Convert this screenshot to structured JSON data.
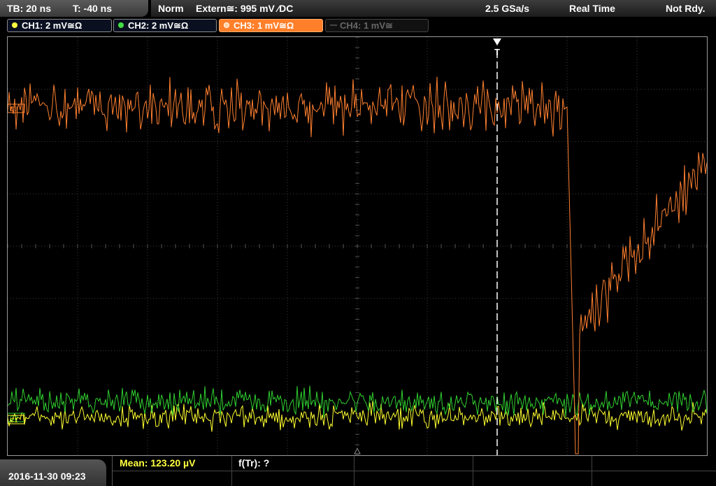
{
  "timebase": {
    "tb": "TB: 20 ns",
    "trigger_time": "T: -40 ns"
  },
  "status": {
    "mode": "Norm",
    "source": "Extern≅: 995 mV ⁄DC",
    "sample_rate": "2.5 GSa/s",
    "acq": "Real Time",
    "ready": "Not Rdy."
  },
  "channels": [
    {
      "label": "CH1: 2 mV≅Ω",
      "color": "#ffff40",
      "state": "on"
    },
    {
      "label": "CH2: 2 mV≅Ω",
      "color": "#40e040",
      "state": "on"
    },
    {
      "label": "CH3: 1 mV≅Ω",
      "color": "#ff7f2a",
      "state": "selected"
    },
    {
      "label": "CH4: 1 mV≅",
      "color": "#555555",
      "state": "off"
    }
  ],
  "markers": {
    "trigger": "T",
    "ch3": "C3",
    "ch1": "C1",
    "ch2": "C2"
  },
  "colors": {
    "ch1": "#ffff30",
    "ch2": "#30d030",
    "ch3": "#ff8030",
    "grid": "#3a3a3a"
  },
  "bottom": {
    "datetime": "2016-11-30 09:23",
    "meas1": "Mean: 123.20 µV",
    "meas2": "f(Tr): ?"
  }
}
